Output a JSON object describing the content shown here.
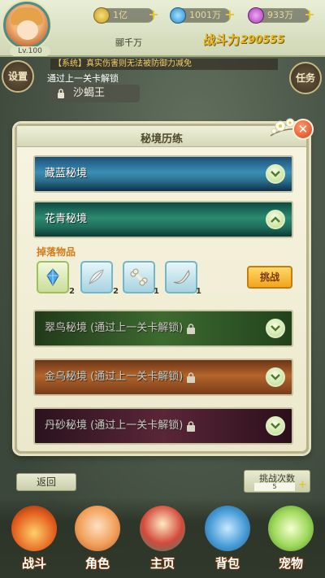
{
  "header": {
    "level": "Lv.100",
    "player_name": "郦千万",
    "power_label": "战斗力",
    "power_value": "290555",
    "gold": "1亿",
    "gems": "1001万",
    "orbs": "933万"
  },
  "hud": {
    "settings_label": "设置",
    "task_label": "任务",
    "marquee": "【系统】真实伤害则无法被防御力减免",
    "pass_hint": "通过上一关卡解锁",
    "boss_name": "沙蝎王"
  },
  "modal": {
    "title": "秘境历练",
    "stages": [
      {
        "name": "藏蓝秘境",
        "locked": false,
        "expanded": false
      },
      {
        "name": "花青秘境",
        "locked": false,
        "expanded": true
      },
      {
        "name": "翠鸟秘境 (通过上一关卡解锁)",
        "locked": true,
        "expanded": false
      },
      {
        "name": "金乌秘境 (通过上一关卡解锁)",
        "locked": true,
        "expanded": false
      },
      {
        "name": "丹砂秘境 (通过上一关卡解锁)",
        "locked": true,
        "expanded": false
      }
    ],
    "drops_label": "掉落物品",
    "drops": [
      {
        "icon": "crystal-icon",
        "count": "2"
      },
      {
        "icon": "feather-icon",
        "count": "2"
      },
      {
        "icon": "bone-icon",
        "count": "1"
      },
      {
        "icon": "horn-icon",
        "count": "1"
      }
    ],
    "challenge_label": "挑战"
  },
  "footer": {
    "back_label": "返回",
    "tries_label": "挑战次数",
    "tries_value": "5"
  },
  "nav": [
    {
      "label": "战斗"
    },
    {
      "label": "角色"
    },
    {
      "label": "主页"
    },
    {
      "label": "背包"
    },
    {
      "label": "宠物"
    }
  ]
}
